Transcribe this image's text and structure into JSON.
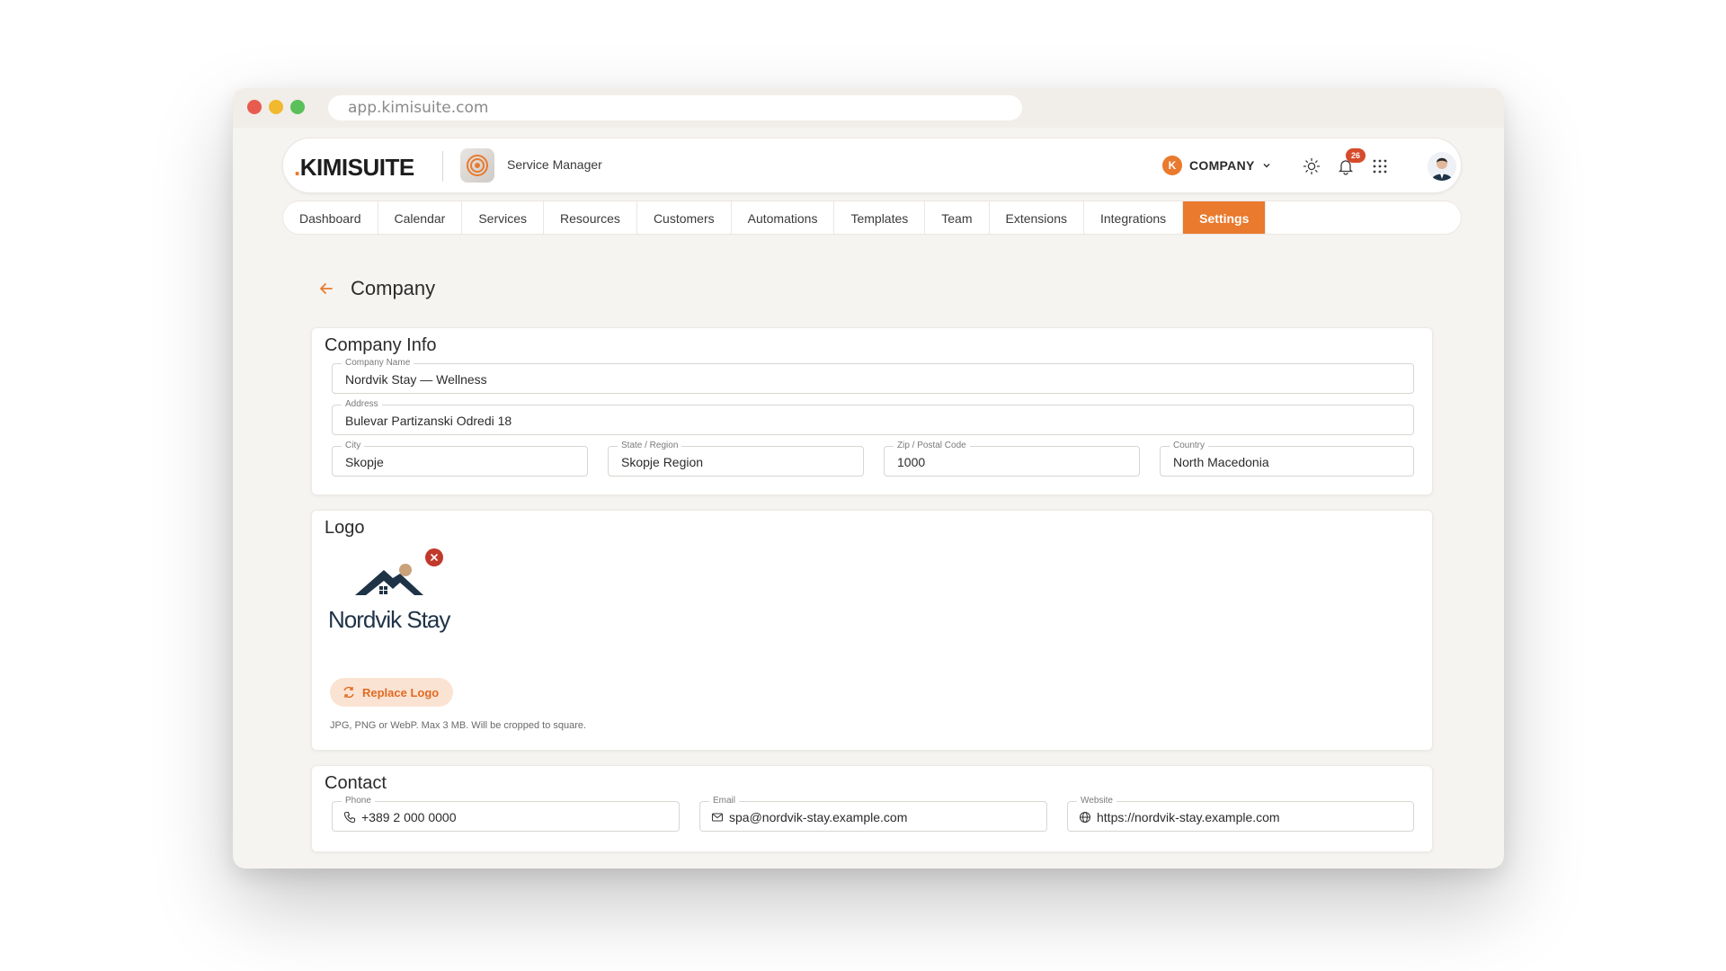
{
  "browser": {
    "url": "app.kimisuite.com"
  },
  "header": {
    "brand": "KIMISUITE",
    "brand_dot": ".",
    "app_name": "Service Manager",
    "company_initial": "K",
    "company_label": "COMPANY",
    "notification_count": "26"
  },
  "nav": {
    "items": [
      {
        "label": "Dashboard"
      },
      {
        "label": "Calendar"
      },
      {
        "label": "Services"
      },
      {
        "label": "Resources"
      },
      {
        "label": "Customers"
      },
      {
        "label": "Automations"
      },
      {
        "label": "Templates"
      },
      {
        "label": "Team"
      },
      {
        "label": "Extensions"
      },
      {
        "label": "Integrations"
      },
      {
        "label": "Settings"
      }
    ],
    "active": "Settings"
  },
  "page": {
    "title": "Company"
  },
  "company_info": {
    "title": "Company Info",
    "company_name": {
      "label": "Company Name",
      "value": "Nordvik Stay — Wellness"
    },
    "address": {
      "label": "Address",
      "value": "Bulevar Partizanski Odredi 18"
    },
    "city": {
      "label": "City",
      "value": "Skopje"
    },
    "state": {
      "label": "State / Region",
      "value": "Skopje Region"
    },
    "zip": {
      "label": "Zip / Postal Code",
      "value": "1000"
    },
    "country": {
      "label": "Country",
      "value": "North Macedonia"
    }
  },
  "logo": {
    "title": "Logo",
    "logo_text": "Nordvik Stay",
    "replace_label": "Replace Logo",
    "hint": "JPG, PNG or WebP. Max 3 MB. Will be cropped to square."
  },
  "contact": {
    "title": "Contact",
    "phone": {
      "label": "Phone",
      "value": "+389 2 000 0000"
    },
    "email": {
      "label": "Email",
      "value": "spa@nordvik-stay.example.com"
    },
    "website": {
      "label": "Website",
      "value": "https://nordvik-stay.example.com"
    }
  },
  "colors": {
    "accent": "#e97a2e",
    "danger": "#c0392b",
    "logo_navy": "#1f3347",
    "logo_sun": "#c9a27a"
  }
}
